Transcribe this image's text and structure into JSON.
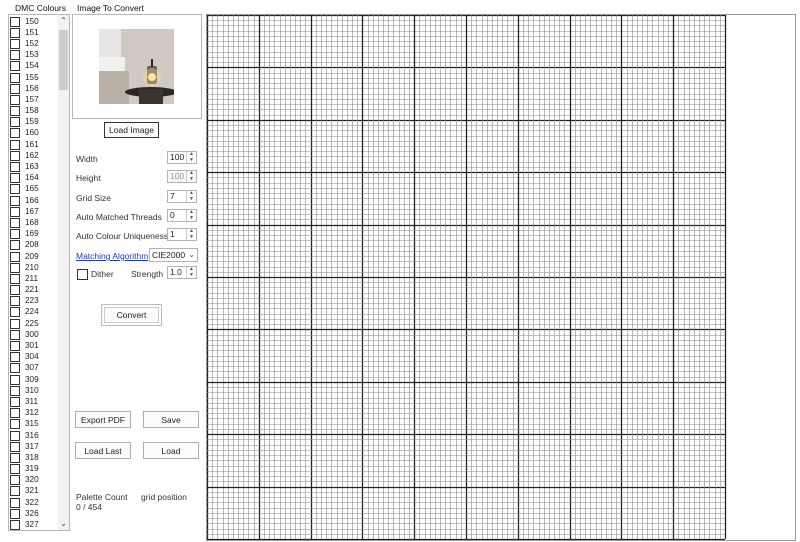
{
  "headers": {
    "dmc_colours": "DMC Colours",
    "image_to_convert": "Image To Convert"
  },
  "dmc_list": [
    "150",
    "151",
    "152",
    "153",
    "154",
    "155",
    "156",
    "157",
    "158",
    "159",
    "160",
    "161",
    "162",
    "163",
    "164",
    "165",
    "166",
    "167",
    "168",
    "169",
    "208",
    "209",
    "210",
    "211",
    "221",
    "223",
    "224",
    "225",
    "300",
    "301",
    "304",
    "307",
    "309",
    "310",
    "311",
    "312",
    "315",
    "316",
    "317",
    "318",
    "319",
    "320",
    "321",
    "322",
    "326",
    "327"
  ],
  "buttons": {
    "load_image": "Load Image",
    "convert": "Convert",
    "export_pdf": "Export PDF",
    "save": "Save",
    "load_last": "Load Last",
    "load": "Load"
  },
  "settings": {
    "width_label": "Width",
    "width_value": "100",
    "height_label": "Height",
    "height_value": "100",
    "grid_size_label": "Grid Size",
    "grid_size_value": "7",
    "auto_matched_label": "Auto Matched Threads",
    "auto_matched_value": "0",
    "auto_uniqueness_label": "Auto Colour Uniqueness",
    "auto_uniqueness_value": "1",
    "matching_algorithm_label": "Matching Algorithm",
    "matching_algorithm_value": "CIE2000",
    "dither_label": "Dither",
    "strength_label": "Strength",
    "strength_value": "1.0"
  },
  "status": {
    "palette_count_label": "Palette Count",
    "grid_position_label": "grid position",
    "palette_count_value": "0 / 454"
  },
  "icons": {
    "scroll_up": "chevron-up-icon",
    "scroll_down": "chevron-down-icon",
    "dropdown": "chevron-down-icon"
  }
}
